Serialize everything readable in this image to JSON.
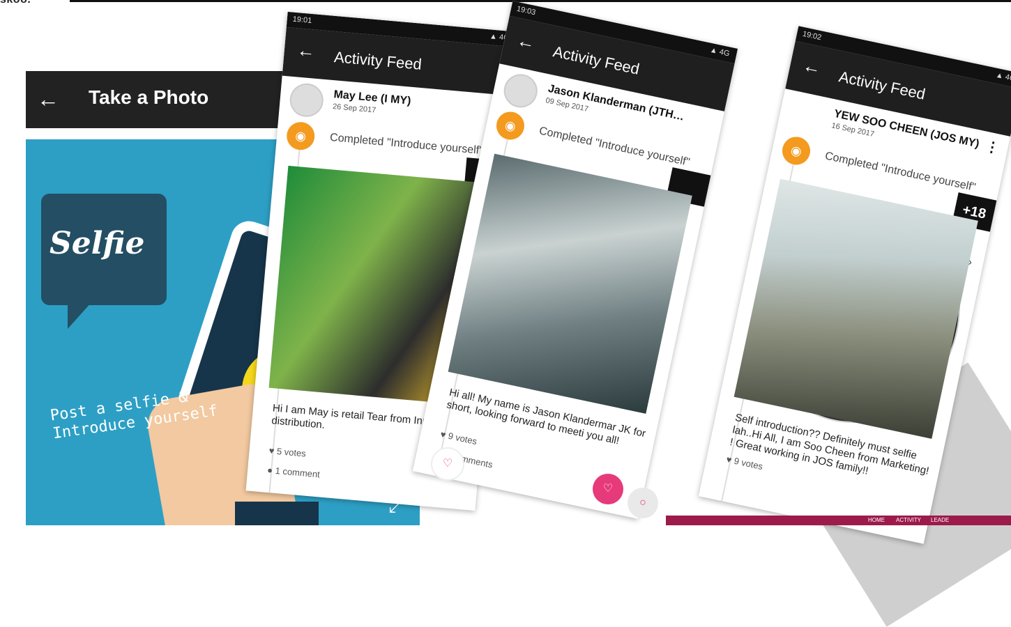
{
  "top_label": "skoo.",
  "photo_screen": {
    "title": "Take a Photo",
    "selfie_word": "Selfie",
    "post_text_line1": "Post a selfie &",
    "post_text_line2": "Introduce yourself"
  },
  "feed": {
    "title": "Activity Feed",
    "cards": [
      {
        "time": "19:01",
        "name": "May Lee (I MY)",
        "date": "26 Sep 2017",
        "activity": "Completed \"Introduce yourself\"",
        "caption": "Hi I am May is retail Tear from Innovix distribution.",
        "votes": "5 votes",
        "comments": "1 comment"
      },
      {
        "time": "19:03",
        "name": "Jason Klanderman (JTH…",
        "date": "09 Sep 2017",
        "activity": "Completed \"Introduce yourself\"",
        "caption": "Hi all! My name is Jason Klandermar JK for short, looking forward to meeti you all!",
        "votes": "9 votes",
        "comments": "2 comments"
      },
      {
        "time": "19:02",
        "name": "YEW SOO CHEEN (JOS MY)",
        "date": "16 Sep 2017",
        "activity": "Completed \"Introduce yourself\"",
        "caption": "Self introduction?? Definitely must selfie lah..Hi All, I am Soo Cheen from Marketing! ! Great working in JOS family!!",
        "votes": "9 votes",
        "points": "+18"
      }
    ]
  },
  "bottom_bar": {
    "home": "HOME",
    "activity": "ACTIVITY",
    "leader": "LEADE"
  }
}
